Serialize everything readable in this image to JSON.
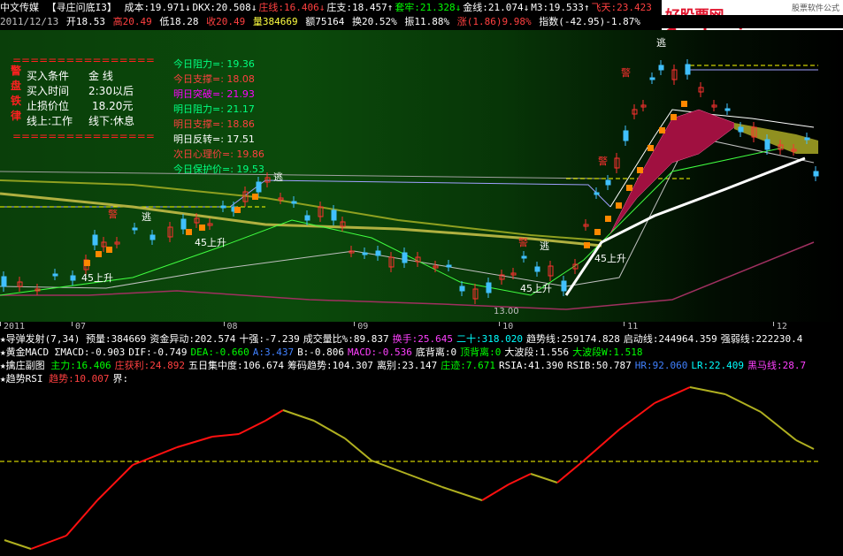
{
  "header": {
    "app": "中文传媒",
    "formula": "【寻庄问底I3】",
    "items": [
      {
        "label": "成本:19.971",
        "arrow": "↓",
        "color": "#ffffff"
      },
      {
        "label": "DKX:20.508",
        "arrow": "↓",
        "color": "#ffffff"
      },
      {
        "label": "庄线:16.406",
        "arrow": "↓",
        "color": "#ff4040"
      },
      {
        "label": "庄支:18.457",
        "arrow": "↑",
        "color": "#ffffff"
      },
      {
        "label": "套牢:21.328",
        "arrow": "↓",
        "color": "#00ff00"
      },
      {
        "label": "金线:21.074",
        "arrow": "↓",
        "color": "#ffffff"
      },
      {
        "label": "M3:19.533",
        "arrow": "↑",
        "color": "#ffffff"
      },
      {
        "label": "飞天:23.423",
        "arrow": "",
        "color": "#ff4040"
      }
    ]
  },
  "logo": {
    "main": "好股票网Goodgupiao.com",
    "sub": "股票软件公式"
  },
  "quote": {
    "date": "2011/12/13",
    "open": "开18.53",
    "high": "高20.49",
    "low": "低18.28",
    "close": "收20.49",
    "vol": "量384669",
    "amount": "额75164",
    "turnover": "换20.52%",
    "amplitude": "振11.88%",
    "change": "涨(1.86)9.98%",
    "index": "指数(-42.95)-1.87%"
  },
  "conditions": {
    "rows": [
      {
        "k": "买入条件",
        "v": "金  线"
      },
      {
        "k": "买入时间",
        "v": "2:30以后"
      },
      {
        "k": "止损价位",
        "v": "18.20元"
      },
      {
        "k": "线上:工作",
        "v": "线下:休息"
      }
    ],
    "side_chars": [
      "警",
      "盘",
      "铁",
      "律"
    ],
    "divider": "================"
  },
  "levels": [
    {
      "label": "今日阻力=: 19.36",
      "color": "#00ff80"
    },
    {
      "label": "今日支撑=: 18.08",
      "color": "#ff4040"
    },
    {
      "label": "明日突破=: 21.93",
      "color": "#ff00ff"
    },
    {
      "label": "明日阻力=: 21.17",
      "color": "#00ff80"
    },
    {
      "label": "明日支撑=: 18.86",
      "color": "#ff4040"
    },
    {
      "label": "明日反转=: 17.51",
      "color": "#ffffff"
    },
    {
      "label": "次日心理价=: 19.86",
      "color": "#ff4040"
    },
    {
      "label": "今日保护价=: 19.53",
      "color": "#00ff80"
    }
  ],
  "tags": {
    "escape": "逃",
    "warn": "警",
    "rise45": "45上升",
    "low_price": "13.00"
  },
  "date_axis": [
    {
      "label": "2011",
      "pos": 0
    },
    {
      "label": "07",
      "pos": 0.085
    },
    {
      "label": "08",
      "pos": 0.265
    },
    {
      "label": "09",
      "pos": 0.42
    },
    {
      "label": "10",
      "pos": 0.592
    },
    {
      "label": "11",
      "pos": 0.74
    },
    {
      "label": "12",
      "pos": 0.917
    }
  ],
  "indicators": [
    {
      "name": "导弹发射(7,34)",
      "items": [
        {
          "t": "预量:384669",
          "c": "#ffffff"
        },
        {
          "t": "资金异动:202.574",
          "c": "#ffffff"
        },
        {
          "t": "十强:-7.239",
          "c": "#ffffff"
        },
        {
          "t": "成交量比%:89.837",
          "c": "#ffffff"
        },
        {
          "t": "换手:25.645",
          "c": "#ff40ff"
        },
        {
          "t": "二十:318.020",
          "c": "#00ffff"
        },
        {
          "t": "趋势线:259174.828",
          "c": "#ffffff"
        },
        {
          "t": "启动线:244964.359",
          "c": "#ffffff"
        },
        {
          "t": "强弱线:222230.4",
          "c": "#ffffff"
        }
      ]
    },
    {
      "name": "黄金MACD",
      "items": [
        {
          "t": "ΣMACD:-0.903",
          "c": "#ffffff"
        },
        {
          "t": "DIF:-0.749",
          "c": "#ffffff"
        },
        {
          "t": "DEA:-0.660",
          "c": "#00ff00"
        },
        {
          "t": "A:3.437",
          "c": "#4080ff"
        },
        {
          "t": "B:-0.806",
          "c": "#ffffff"
        },
        {
          "t": "MACD:-0.536",
          "c": "#ff40ff"
        },
        {
          "t": "底背离:0",
          "c": "#ffffff"
        },
        {
          "t": "顶背离:0",
          "c": "#00ff00"
        },
        {
          "t": "大波段:1.556",
          "c": "#ffffff"
        },
        {
          "t": "大波段W:1.518",
          "c": "#00ff00"
        }
      ]
    },
    {
      "name": "擒庄副图",
      "items": [
        {
          "t": "主力:16.406",
          "c": "#00ff00"
        },
        {
          "t": "庄获利:24.892",
          "c": "#ff4040"
        },
        {
          "t": "五日集中度:106.674",
          "c": "#ffffff"
        },
        {
          "t": "筹码趋势:104.307",
          "c": "#ffffff"
        },
        {
          "t": "离别:23.147",
          "c": "#ffffff"
        },
        {
          "t": "庄迹:7.671",
          "c": "#00ff00"
        },
        {
          "t": "RSIA:41.390",
          "c": "#ffffff"
        },
        {
          "t": "RSIB:50.787",
          "c": "#ffffff"
        },
        {
          "t": "HR:92.060",
          "c": "#4080ff"
        },
        {
          "t": "LR:22.409",
          "c": "#00ffff"
        },
        {
          "t": "黑马线:28.7",
          "c": "#ff40ff"
        }
      ]
    },
    {
      "name": "趋势RSI",
      "items": [
        {
          "t": "趋势:10.007",
          "c": "#ff4040"
        },
        {
          "t": "界:",
          "c": "#ffffff"
        }
      ]
    }
  ],
  "colors": {
    "up": "#ff3030",
    "down": "#40c0ff",
    "orange": "#ff8800",
    "yellow": "#ffff00",
    "magenta": "#c01050",
    "rsi_up": "#ff1010",
    "rsi_dn": "#b0b020"
  }
}
